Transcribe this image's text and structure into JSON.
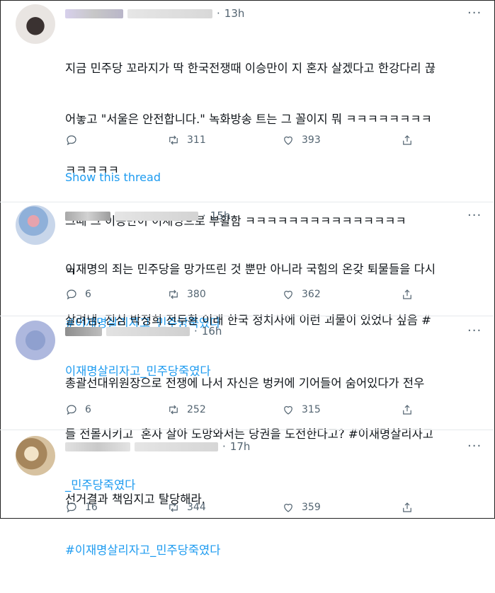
{
  "tweets": [
    {
      "time": "13h",
      "text_lines": [
        "지금 민주당 꼬라지가 딱 한국전쟁때 이승만이 지 혼자 살겠다고 한강다리 끊",
        "어놓고 \"서울은 안전합니다.\" 녹화방송 트는 그 꼴이지 뭐 ㅋㅋㅋㅋㅋㅋㅋㅋ",
        "ㅋㅋㅋㅋㅋ",
        "그때 그 이승만이 이재명으로 부활함 ㅋㅋㅋㅋㅋㅋㅋㅋㅋㅋㅋㅋㅋㅋㅋ",
        "ㅋ"
      ],
      "hashtag": "#이재명살리자고_민주당죽였다",
      "replies": "",
      "retweets": "311",
      "likes": "393",
      "show_thread": "Show this thread"
    },
    {
      "time": "15h",
      "text_lines": [
        "이재명의 죄는 민주당을 망가뜨린 것 뿐만 아니라 국힘의 온갖 퇴물들을 다시",
        "살려냄. 진심 박정희 전두환 이래 한국 정치사에 이런 괴물이 있었나 싶음 #"
      ],
      "hashtag": "이재명살리자고_민주당죽였다",
      "replies": "6",
      "retweets": "380",
      "likes": "362"
    },
    {
      "time": "16h",
      "text_lines": [
        "총괄선대위원장으로 전쟁에 나서 자신은 벙커에 기어들어 숨어있다가 전우",
        "들 전몰시키고  혼자 살아 도망와서는 당권을 도전한다고? #이재명살리자고"
      ],
      "hashtag": "_민주당죽였다",
      "replies": "6",
      "retweets": "252",
      "likes": "315"
    },
    {
      "time": "17h",
      "text_lines": [
        "선거결과 책임지고 탈당해라."
      ],
      "hashtag": "#이재명살리자고_민주당죽였다",
      "replies": "16",
      "retweets": "344",
      "likes": "359"
    }
  ],
  "icons": [
    "reply-icon",
    "retweet-icon",
    "like-icon",
    "share-icon",
    "more-icon"
  ],
  "colors": {
    "link": "#1d9bf0",
    "muted": "#536471",
    "text": "#0f1419"
  }
}
